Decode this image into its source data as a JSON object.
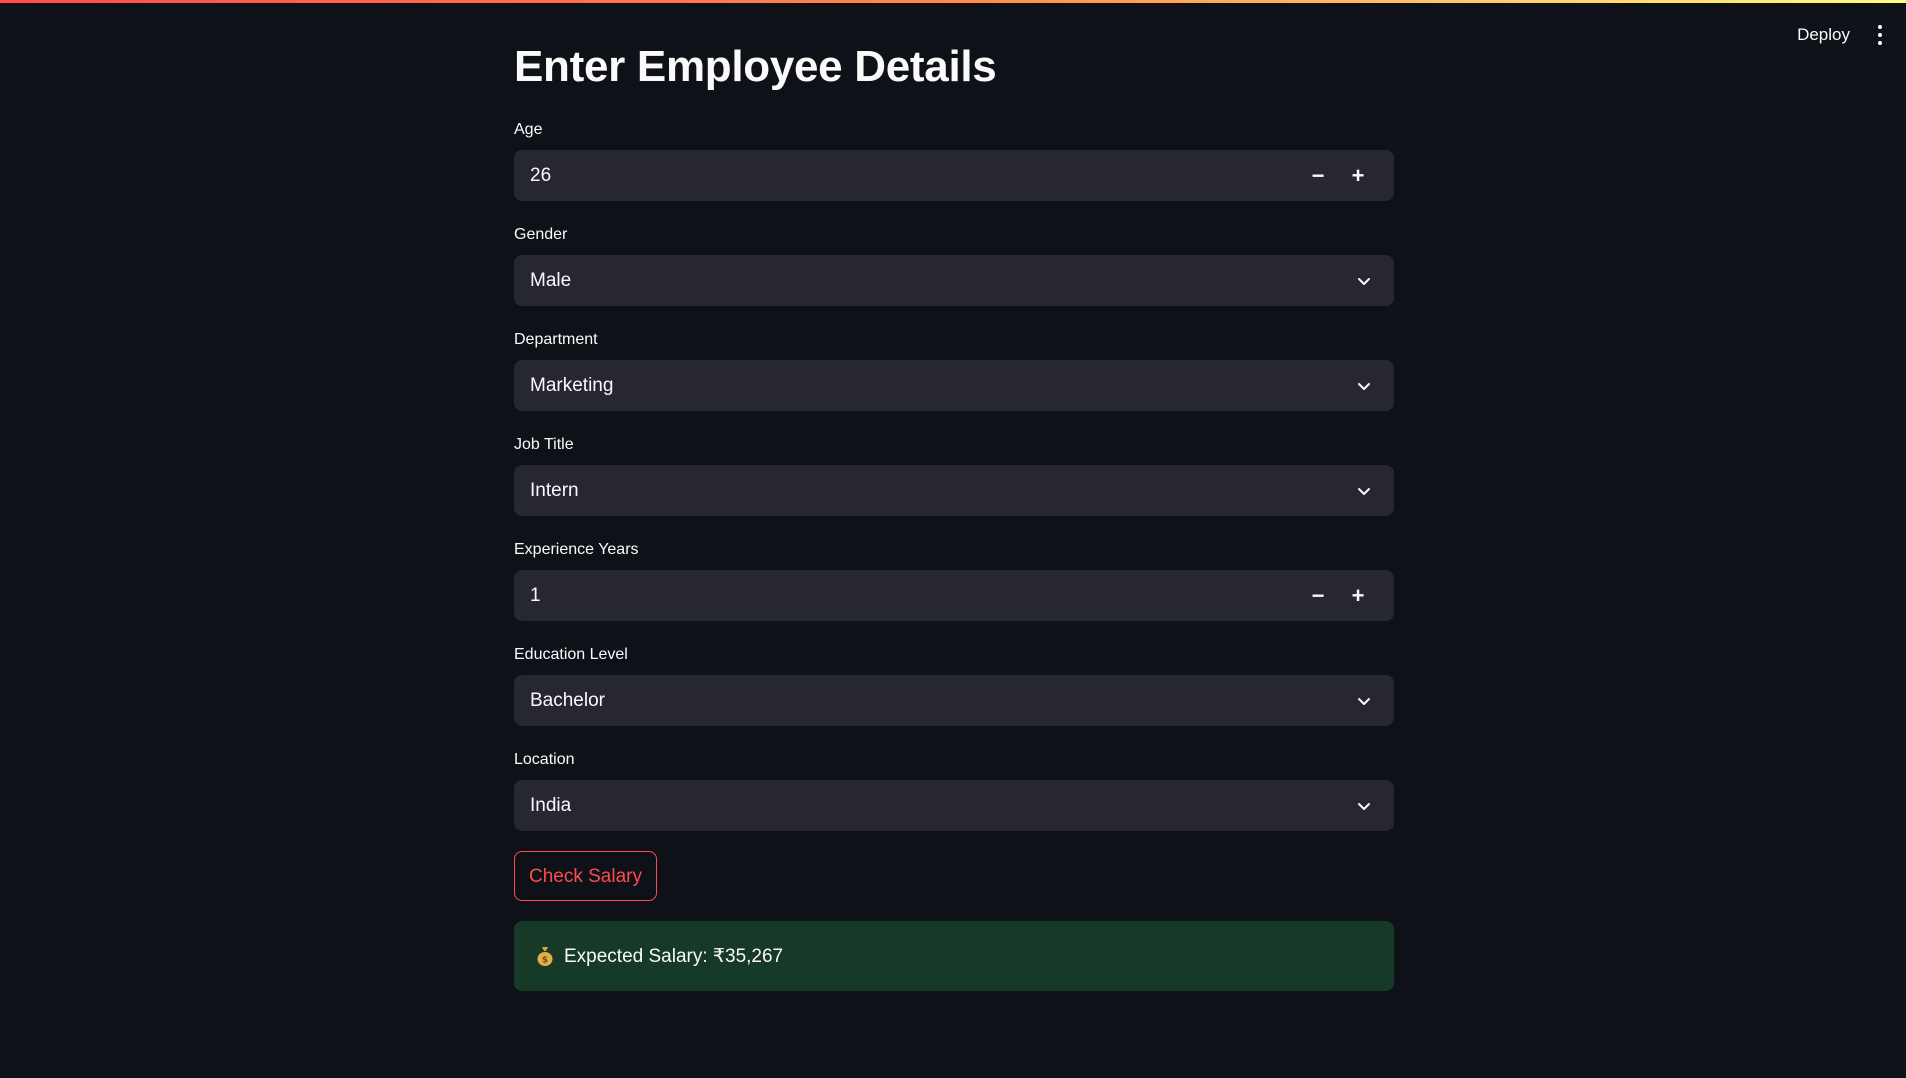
{
  "header": {
    "deploy_label": "Deploy",
    "menu_icon": "vertical-dots-icon"
  },
  "page": {
    "title": "Enter Employee Details"
  },
  "fields": {
    "age": {
      "label": "Age",
      "value": "26",
      "minus": "−",
      "plus": "+"
    },
    "gender": {
      "label": "Gender",
      "value": "Male"
    },
    "department": {
      "label": "Department",
      "value": "Marketing"
    },
    "job_title": {
      "label": "Job Title",
      "value": "Intern"
    },
    "experience": {
      "label": "Experience Years",
      "value": "1",
      "minus": "−",
      "plus": "+"
    },
    "education": {
      "label": "Education Level",
      "value": "Bachelor"
    },
    "location": {
      "label": "Location",
      "value": "India"
    }
  },
  "actions": {
    "check_label": "Check Salary"
  },
  "result": {
    "icon": "money-bag-icon",
    "text": "Expected Salary: ₹35,267"
  },
  "colors": {
    "background": "#0e1117",
    "input_bg": "#262730",
    "accent": "#ff4b4b",
    "success_bg": "#173928"
  }
}
